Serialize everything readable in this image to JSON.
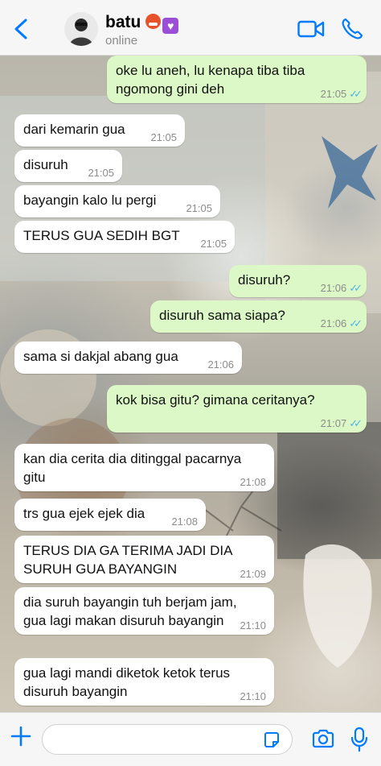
{
  "header": {
    "contact_name": "batu",
    "status": "online"
  },
  "icons": {
    "back": "chevron-left-icon",
    "video": "video-camera-icon",
    "call": "phone-icon",
    "attach": "plus-icon",
    "sticker": "sticker-icon",
    "camera": "camera-icon",
    "mic": "microphone-icon"
  },
  "colors": {
    "accent": "#007aff",
    "outgoing_bubble": "#dcf8c6",
    "incoming_bubble": "#ffffff",
    "read_ticks": "#4fb6ec"
  },
  "messages": [
    {
      "dir": "out",
      "lines": [
        "oke lu aneh, lu kenapa tiba tiba",
        "ngomong gini deh"
      ],
      "time": "21:05"
    },
    {
      "dir": "in",
      "lines": [
        "dari kemarin gua"
      ],
      "time": "21:05"
    },
    {
      "dir": "in",
      "lines": [
        "disuruh"
      ],
      "time": "21:05"
    },
    {
      "dir": "in",
      "lines": [
        "bayangin kalo lu pergi"
      ],
      "time": "21:05"
    },
    {
      "dir": "in",
      "lines": [
        "TERUS GUA SEDIH BGT"
      ],
      "time": "21:05"
    },
    {
      "dir": "out",
      "lines": [
        "disuruh?"
      ],
      "time": "21:06"
    },
    {
      "dir": "out",
      "lines": [
        "disuruh sama siapa?"
      ],
      "time": "21:06"
    },
    {
      "dir": "in",
      "lines": [
        "sama si dakjal abang gua"
      ],
      "time": "21:06"
    },
    {
      "dir": "out",
      "lines": [
        "kok bisa gitu? gimana ceritanya?"
      ],
      "time": "21:07"
    },
    {
      "dir": "in",
      "lines": [
        "kan dia cerita dia ditinggal pacarnya",
        "gitu"
      ],
      "time": "21:08"
    },
    {
      "dir": "in",
      "lines": [
        "trs gua ejek ejek dia"
      ],
      "time": "21:08"
    },
    {
      "dir": "in",
      "lines": [
        "TERUS DIA GA TERIMA JADI DIA",
        "SURUH GUA BAYANGIN"
      ],
      "time": "21:09"
    },
    {
      "dir": "in",
      "lines": [
        "dia suruh bayangin tuh berjam jam,",
        "gua lagi makan disuruh bayangin"
      ],
      "time": "21:10"
    },
    {
      "dir": "in",
      "lines": [
        "gua lagi mandi diketok ketok terus",
        "disuruh bayangin"
      ],
      "time": "21:10"
    }
  ],
  "composer": {
    "value": ""
  }
}
